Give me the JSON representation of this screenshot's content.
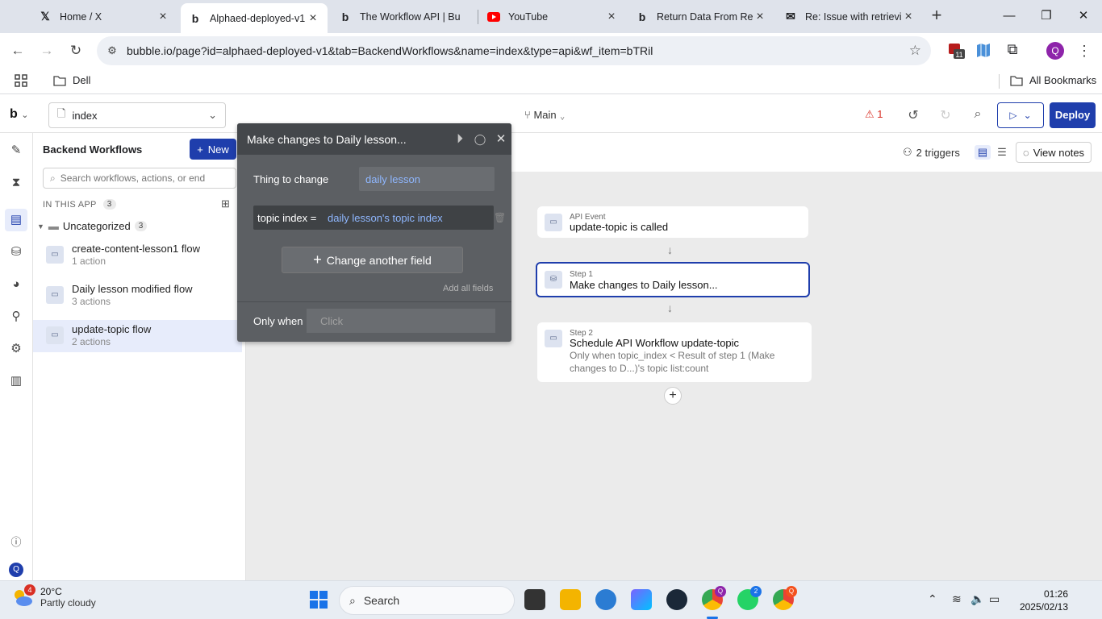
{
  "browser": {
    "tabs": [
      {
        "title": "Home / X",
        "icon": "x-logo-icon",
        "active": false
      },
      {
        "title": "Alphaed-deployed-v1",
        "icon": "bubble-logo-icon",
        "active": true
      },
      {
        "title": "The Workflow API | Bu",
        "icon": "bubble-logo-icon",
        "active": false
      },
      {
        "title": "YouTube",
        "icon": "youtube-icon",
        "active": false
      },
      {
        "title": "Return Data From Re",
        "icon": "bubble-logo-icon",
        "active": false
      },
      {
        "title": "Re: Issue with retrievi",
        "icon": "mail-icon",
        "active": false
      }
    ],
    "url": "bubble.io/page?id=alphaed-deployed-v1&tab=BackendWorkflows&name=index&type=api&wf_item=bTRil",
    "bookmarks": {
      "folder": "Dell",
      "all": "All Bookmarks"
    },
    "extension_badge": "11",
    "profile_initial": "Q"
  },
  "editor": {
    "page_selector": "index",
    "branch": "Main",
    "issues_count": "1",
    "deploy_label": "Deploy"
  },
  "panel": {
    "title": "Backend Workflows",
    "new_label": "New",
    "search_placeholder": "Search workflows, actions, or end",
    "section_label": "IN THIS APP",
    "section_count": "3",
    "folder_name": "Uncategorized",
    "folder_count": "3",
    "workflows": [
      {
        "name": "create-content-lesson1 flow",
        "actions": "1 action"
      },
      {
        "name": "Daily lesson modified flow",
        "actions": "3 actions"
      },
      {
        "name": "update-topic flow",
        "actions": "2 actions"
      }
    ]
  },
  "canvas": {
    "triggers": "2 triggers",
    "view_notes": "View notes",
    "cards": [
      {
        "label": "API Event",
        "title": "update-topic is called"
      },
      {
        "label": "Step 1",
        "title": "Make changes to Daily lesson..."
      },
      {
        "label": "Step 2",
        "title": "Schedule API Workflow update-topic",
        "condition": "Only when topic_index < Result of step 1 (Make changes to D...)'s topic list:count"
      }
    ]
  },
  "popup": {
    "title": "Make changes to Daily lesson...",
    "thing_label": "Thing to change",
    "thing_value": "daily lesson",
    "field_name": "topic index",
    "field_equals": "=",
    "field_value": "daily lesson's topic index",
    "change_another": "Change another field",
    "add_all": "Add all fields",
    "only_when_label": "Only when",
    "only_when_placeholder": "Click"
  },
  "taskbar": {
    "weather_temp": "20°C",
    "weather_cond": "Partly cloudy",
    "weather_badge": "4",
    "search_label": "Search",
    "time": "01:26",
    "date": "2025/02/13",
    "whatsapp_badge": "2"
  },
  "colors": {
    "bubble_blue": "#1f3eac",
    "popup_bg": "#5c5f63",
    "link_blue": "#8fb7ff",
    "canvas_bg": "#ebebeb"
  }
}
